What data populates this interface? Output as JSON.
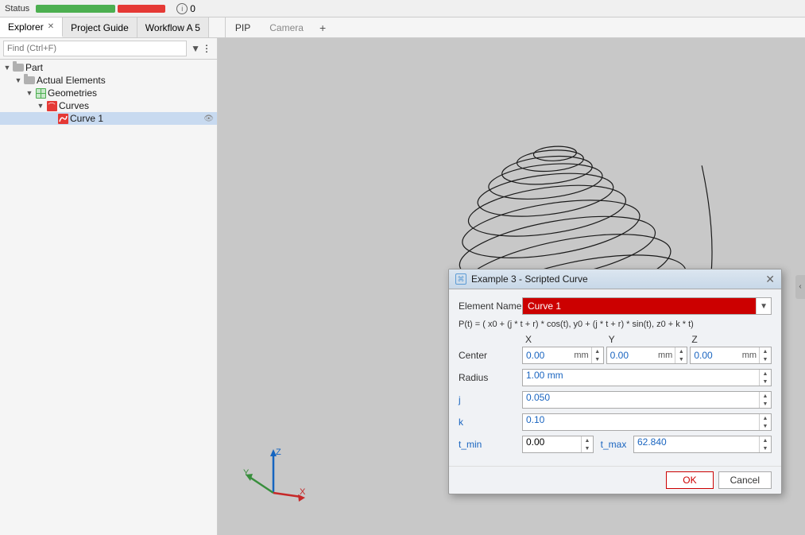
{
  "status": {
    "label": "Status",
    "info_count": "0"
  },
  "tabs": {
    "items": [
      {
        "label": "Explorer",
        "active": true,
        "closable": true
      },
      {
        "label": "Project Guide",
        "active": false,
        "closable": false
      },
      {
        "label": "Workflow A 5",
        "active": false,
        "closable": false
      }
    ],
    "viewport_tabs": [
      {
        "label": "PIP",
        "active": true
      },
      {
        "label": "Camera",
        "active": false
      }
    ],
    "add_label": "+"
  },
  "sidebar": {
    "search_placeholder": "Find (Ctrl+F)",
    "tree": [
      {
        "label": "Part",
        "level": 0,
        "expanded": true,
        "type": "part"
      },
      {
        "label": "Actual Elements",
        "level": 1,
        "expanded": true,
        "type": "folder"
      },
      {
        "label": "Geometries",
        "level": 2,
        "expanded": true,
        "type": "geo"
      },
      {
        "label": "Curves",
        "level": 3,
        "expanded": true,
        "type": "curves"
      },
      {
        "label": "Curve 1",
        "level": 4,
        "expanded": false,
        "type": "curve",
        "selected": true
      }
    ]
  },
  "dialog": {
    "title": "Example 3 - Scripted Curve",
    "element_name_label": "Element Name",
    "element_name_value": "Curve 1",
    "formula": "P(t) = ( x0 + (j * t + r) * cos(t), y0 + (j * t + r) * sin(t), z0 + k * t)",
    "headers": {
      "x": "X",
      "y": "Y",
      "z": "Z"
    },
    "center_label": "Center",
    "center_x": "0.00 mm",
    "center_y": "0.00 mm",
    "center_z": "0.00 mm",
    "radius_label": "Radius",
    "radius_value": "1.00 mm",
    "j_label": "j",
    "j_value": "0.050",
    "k_label": "k",
    "k_value": "0.10",
    "tmin_label": "t_min",
    "tmin_value": "0.00",
    "tmax_label": "t_max",
    "tmax_value": "62.840",
    "ok_label": "OK",
    "cancel_label": "Cancel"
  }
}
